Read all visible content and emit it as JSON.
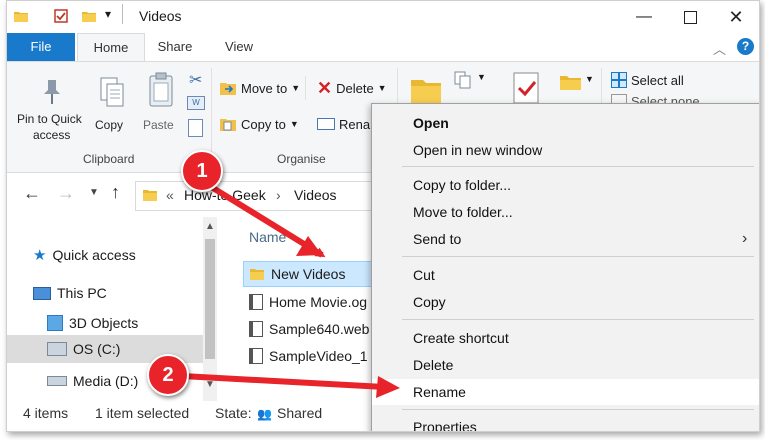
{
  "window": {
    "title": "Videos"
  },
  "tabs": {
    "file": "File",
    "home": "Home",
    "share": "Share",
    "view": "View"
  },
  "ribbon": {
    "pin_label": "Pin to Quick\naccess",
    "pin_line1": "Pin to Quick",
    "pin_line2": "access",
    "copy": "Copy",
    "paste": "Paste",
    "clipboard": "Clipboard",
    "move_to": "Move to",
    "copy_to": "Copy to",
    "delete": "Delete",
    "rename": "Renam",
    "organise": "Organise",
    "select_all": "Select all",
    "select_none": "Select none"
  },
  "breadcrumb": {
    "sep": "«",
    "parent": "How-to Geek",
    "arrow": "›",
    "current": "Videos"
  },
  "nav": {
    "quick_access": "Quick access",
    "this_pc": "This PC",
    "objects3d": "3D Objects",
    "os_c": "OS (C:)",
    "media_d": "Media (D:)"
  },
  "filelist": {
    "header": "Name",
    "items": [
      "New Videos",
      "Home Movie.og",
      "Sample640.web",
      "SampleVideo_1"
    ]
  },
  "status": {
    "count": "4 items",
    "selected": "1 item selected",
    "state": "State:",
    "shared": "Shared"
  },
  "context_menu": {
    "open": "Open",
    "open_new_window": "Open in new window",
    "copy_to_folder": "Copy to folder...",
    "move_to_folder": "Move to folder...",
    "send_to": "Send to",
    "cut": "Cut",
    "copy": "Copy",
    "create_shortcut": "Create shortcut",
    "delete": "Delete",
    "rename": "Rename",
    "properties": "Properties"
  },
  "callouts": {
    "one": "1",
    "two": "2"
  },
  "colors": {
    "accent": "#1979ca",
    "callout": "#e8232a",
    "selected_row": "#cce8ff"
  }
}
